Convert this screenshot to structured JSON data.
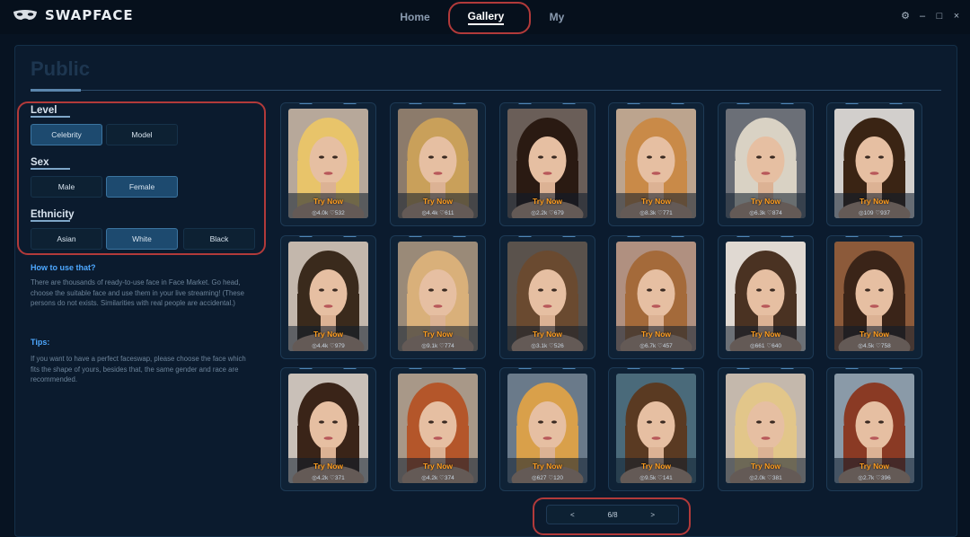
{
  "app": {
    "name": "SWAPFACE"
  },
  "nav": [
    {
      "label": "Home",
      "active": false
    },
    {
      "label": "Gallery",
      "active": true
    },
    {
      "label": "My",
      "active": false
    }
  ],
  "window_controls": {
    "settings": "⚙",
    "minimize": "–",
    "maximize": "□",
    "close": "×"
  },
  "panel": {
    "title": "Public"
  },
  "filters": {
    "level": {
      "label": "Level",
      "options": [
        "Celebrity",
        "Model"
      ],
      "selected": "Celebrity"
    },
    "sex": {
      "label": "Sex",
      "options": [
        "Male",
        "Female"
      ],
      "selected": "Female"
    },
    "ethnicity": {
      "label": "Ethnicity",
      "options": [
        "Asian",
        "White",
        "Black"
      ],
      "selected": "White"
    }
  },
  "help": {
    "how_title": "How to use that?",
    "how_text": "There are thousands of ready-to-use face in Face Market. Go head, choose the suitable face and use them in your live streaming! (These persons do not exists. Similarities with real people are accidental.)",
    "tips_title": "Tips:",
    "tips_text": "If you want to have a perfect faceswap, please choose the face which fits the shape of yours, besides that, the same gender and race are recommended."
  },
  "gallery": {
    "cta": "Try Now",
    "cards": [
      {
        "views": "4.0k",
        "likes": "532"
      },
      {
        "views": "4.4k",
        "likes": "611"
      },
      {
        "views": "2.2k",
        "likes": "679"
      },
      {
        "views": "8.3k",
        "likes": "771"
      },
      {
        "views": "6.3k",
        "likes": "874"
      },
      {
        "views": "109",
        "likes": "937"
      },
      {
        "views": "4.4k",
        "likes": "979"
      },
      {
        "views": "9.1k",
        "likes": "774"
      },
      {
        "views": "3.1k",
        "likes": "526"
      },
      {
        "views": "6.7k",
        "likes": "457"
      },
      {
        "views": "661",
        "likes": "640"
      },
      {
        "views": "4.5k",
        "likes": "758"
      },
      {
        "views": "4.2k",
        "likes": "371"
      },
      {
        "views": "4.2k",
        "likes": "374"
      },
      {
        "views": "627",
        "likes": "120"
      },
      {
        "views": "9.5k",
        "likes": "141"
      },
      {
        "views": "2.0k",
        "likes": "381"
      },
      {
        "views": "2.7k",
        "likes": "396"
      }
    ]
  },
  "pagination": {
    "prev": "<",
    "page": "6/8",
    "next": ">"
  },
  "colors": {
    "accent": "#4ea8ff",
    "cta": "#ff9d1f",
    "annotation": "#b23a3a"
  }
}
